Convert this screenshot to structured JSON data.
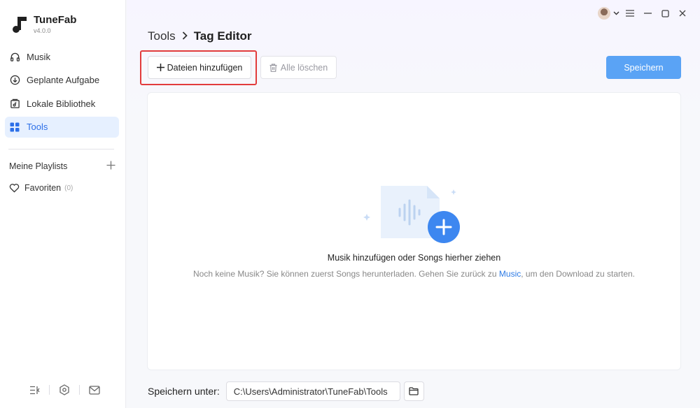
{
  "app": {
    "name": "TuneFab",
    "version": "v4.0.0"
  },
  "sidebar": {
    "items": [
      {
        "label": "Musik",
        "icon": "headphones-icon"
      },
      {
        "label": "Geplante Aufgabe",
        "icon": "download-circle-icon"
      },
      {
        "label": "Lokale Bibliothek",
        "icon": "library-icon"
      },
      {
        "label": "Tools",
        "icon": "grid-icon",
        "active": true
      }
    ],
    "playlists_label": "Meine Playlists",
    "favorites_label": "Favoriten",
    "favorites_count": "(0)"
  },
  "header": {
    "breadcrumb_root": "Tools",
    "breadcrumb_current": "Tag Editor"
  },
  "toolbar": {
    "add_label": "Dateien hinzufügen",
    "clear_label": "Alle löschen",
    "save_label": "Speichern"
  },
  "dropzone": {
    "title": "Musik hinzufügen oder Songs hierher ziehen",
    "hint_before": "Noch keine Musik? Sie können zuerst Songs herunterladen. Gehen Sie zurück zu ",
    "hint_link": "Music",
    "hint_after": ", um den Download zu starten."
  },
  "savebar": {
    "label": "Speichern unter:",
    "path": "C:\\Users\\Administrator\\TuneFab\\Tools"
  },
  "colors": {
    "accent": "#2c6fe8",
    "save_button": "#5aa3f5",
    "highlight": "#e23c3c"
  }
}
